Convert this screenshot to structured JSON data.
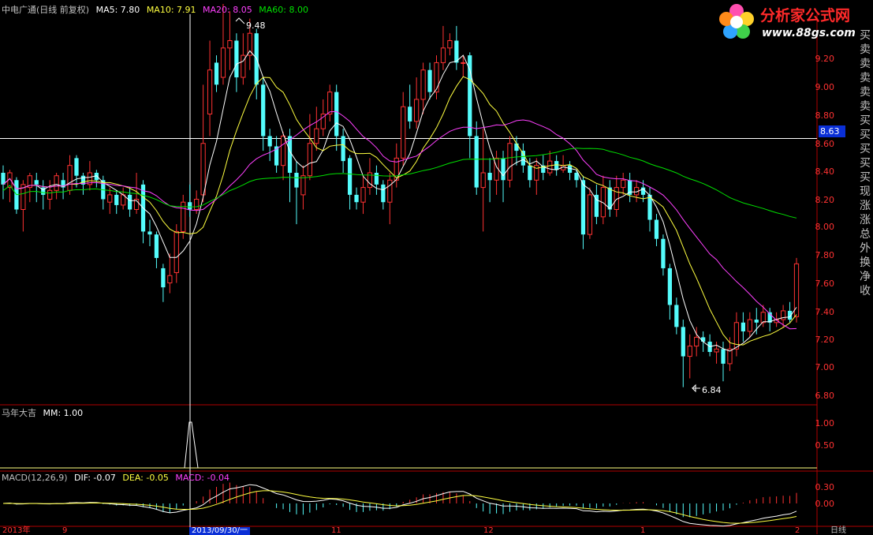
{
  "header": {
    "stock_name": "中电广通(日线 前复权)",
    "ma5": "MA5: 7.80",
    "ma10": "MA10: 7.91",
    "ma20": "MA20: 8.05",
    "ma60": "MA60: 8.00"
  },
  "colors": {
    "ma5": "#ffffff",
    "ma10": "#ffff40",
    "ma20": "#ff40ff",
    "ma60": "#00e000",
    "up": "#ff3232",
    "down": "#54fcfc",
    "axis": "#b00000"
  },
  "main_axis": {
    "labels": [
      "9.20",
      "9.00",
      "8.80",
      "8.60",
      "8.40",
      "8.20",
      "8.00",
      "7.80",
      "7.60",
      "7.40",
      "7.20",
      "7.00",
      "6.80"
    ]
  },
  "annotations": {
    "high": "9.48",
    "low": "6.84",
    "crosshair_price": "8.63"
  },
  "logo": {
    "title": "分析家公式网",
    "url": "www.88gs.com"
  },
  "right_panel": [
    "买",
    "卖",
    "卖",
    "卖",
    "卖",
    "卖",
    "买",
    "买",
    "买",
    "买",
    "买",
    "现",
    "涨",
    "涨",
    "总",
    "外",
    "换",
    "净",
    "收"
  ],
  "indicator1": {
    "title": "马年大吉",
    "mm": "MM: 1.00",
    "axis": [
      "1.00",
      "0.50"
    ]
  },
  "macd": {
    "title": "MACD(12,26,9)",
    "dif": "DIF: -0.07",
    "dea": "DEA: -0.05",
    "macd": "MACD: -0.04",
    "axis": [
      "0.30",
      "0.00"
    ]
  },
  "dates": {
    "d1": "2013年",
    "d2": "9",
    "crosshair_date": "2013/09/30/一",
    "d3": "11",
    "d4": "12",
    "d5": "1",
    "d6": "2",
    "period": "日线"
  },
  "chart_data": {
    "type": "candlestick",
    "ylim": [
      6.72,
      9.38
    ],
    "candles": [
      [
        8.3,
        8.22,
        8.35,
        8.12
      ],
      [
        8.2,
        8.3,
        8.32,
        8.1
      ],
      [
        8.25,
        8.05,
        8.27,
        8.02
      ],
      [
        8.05,
        8.22,
        8.25,
        7.9
      ],
      [
        8.2,
        8.28,
        8.3,
        8.1
      ],
      [
        8.25,
        8.22,
        8.3,
        8.1
      ],
      [
        8.2,
        8.15,
        8.25,
        8.05
      ],
      [
        8.12,
        8.18,
        8.25,
        8.05
      ],
      [
        8.18,
        8.28,
        8.3,
        8.12
      ],
      [
        8.25,
        8.2,
        8.3,
        8.12
      ],
      [
        8.18,
        8.35,
        8.42,
        8.15
      ],
      [
        8.4,
        8.28,
        8.42,
        8.2
      ],
      [
        8.28,
        8.22,
        8.3,
        8.15
      ],
      [
        8.22,
        8.3,
        8.38,
        8.18
      ],
      [
        8.3,
        8.25,
        8.32,
        8.2
      ],
      [
        8.25,
        8.12,
        8.28,
        8.05
      ],
      [
        8.1,
        8.15,
        8.2,
        8.02
      ],
      [
        8.15,
        8.08,
        8.18,
        8.02
      ],
      [
        8.08,
        8.15,
        8.2,
        8.05
      ],
      [
        8.15,
        8.05,
        8.2,
        8.0
      ],
      [
        8.05,
        8.12,
        8.3,
        8.02
      ],
      [
        8.22,
        7.9,
        8.25,
        7.82
      ],
      [
        7.9,
        7.88,
        7.98,
        7.8
      ],
      [
        7.88,
        7.72,
        7.9,
        7.65
      ],
      [
        7.65,
        7.52,
        7.68,
        7.42
      ],
      [
        7.55,
        7.6,
        7.75,
        7.48
      ],
      [
        7.62,
        7.9,
        7.95,
        7.55
      ],
      [
        7.9,
        8.1,
        8.15,
        7.85
      ],
      [
        8.1,
        8.05,
        8.22,
        8.0
      ],
      [
        8.05,
        8.12,
        8.18,
        8.02
      ],
      [
        8.15,
        8.5,
        8.9,
        8.1
      ],
      [
        8.7,
        9.0,
        9.2,
        8.55
      ],
      [
        9.05,
        8.9,
        9.1,
        8.85
      ],
      [
        8.95,
        9.15,
        9.45,
        8.9
      ],
      [
        9.15,
        9.2,
        9.4,
        9.0
      ],
      [
        9.2,
        8.95,
        9.25,
        8.85
      ],
      [
        8.95,
        9.1,
        9.25,
        8.9
      ],
      [
        9.1,
        9.25,
        9.35,
        9.0
      ],
      [
        9.25,
        8.9,
        9.28,
        8.8
      ],
      [
        8.9,
        8.55,
        8.95,
        8.45
      ],
      [
        8.55,
        8.48,
        8.6,
        8.38
      ],
      [
        8.48,
        8.35,
        8.55,
        8.3
      ],
      [
        8.35,
        8.55,
        8.58,
        8.25
      ],
      [
        8.55,
        8.3,
        8.6,
        8.1
      ],
      [
        8.3,
        8.2,
        8.38,
        7.95
      ],
      [
        8.15,
        8.28,
        8.35,
        8.05
      ],
      [
        8.28,
        8.5,
        8.7,
        8.25
      ],
      [
        8.5,
        8.6,
        8.75,
        8.45
      ],
      [
        8.6,
        8.7,
        8.8,
        8.55
      ],
      [
        8.7,
        8.85,
        8.9,
        8.65
      ],
      [
        8.85,
        8.55,
        8.9,
        8.45
      ],
      [
        8.55,
        8.38,
        8.6,
        8.3
      ],
      [
        8.4,
        8.15,
        8.42,
        8.05
      ],
      [
        8.15,
        8.1,
        8.2,
        8.05
      ],
      [
        8.1,
        8.2,
        8.28,
        8.02
      ],
      [
        8.2,
        8.3,
        8.4,
        8.15
      ],
      [
        8.3,
        8.22,
        8.35,
        8.15
      ],
      [
        8.22,
        8.1,
        8.25,
        8.05
      ],
      [
        8.1,
        8.25,
        8.3,
        7.95
      ],
      [
        8.25,
        8.4,
        8.5,
        8.2
      ],
      [
        8.4,
        8.75,
        8.85,
        8.35
      ],
      [
        8.75,
        8.65,
        8.9,
        8.6
      ],
      [
        8.65,
        8.8,
        8.95,
        8.6
      ],
      [
        8.8,
        9.0,
        9.05,
        8.7
      ],
      [
        9.0,
        8.85,
        9.05,
        8.8
      ],
      [
        8.85,
        9.05,
        9.1,
        8.8
      ],
      [
        9.05,
        9.15,
        9.3,
        9.0
      ],
      [
        9.15,
        9.2,
        9.25,
        9.1
      ],
      [
        9.2,
        9.05,
        9.3,
        9.0
      ],
      [
        9.05,
        9.05,
        9.1,
        8.95
      ],
      [
        9.1,
        8.55,
        9.12,
        8.4
      ],
      [
        8.55,
        8.2,
        8.65,
        8.15
      ],
      [
        8.2,
        8.3,
        8.6,
        7.9
      ],
      [
        8.3,
        8.25,
        8.4,
        8.1
      ],
      [
        8.25,
        8.4,
        8.45,
        8.15
      ],
      [
        8.4,
        8.25,
        8.45,
        8.1
      ],
      [
        8.25,
        8.5,
        8.55,
        8.2
      ],
      [
        8.5,
        8.45,
        8.55,
        8.35
      ],
      [
        8.45,
        8.35,
        8.5,
        8.3
      ],
      [
        8.35,
        8.25,
        8.4,
        8.2
      ],
      [
        8.25,
        8.35,
        8.4,
        8.15
      ],
      [
        8.35,
        8.3,
        8.42,
        8.25
      ],
      [
        8.3,
        8.38,
        8.45,
        8.28
      ],
      [
        8.38,
        8.32,
        8.42,
        8.28
      ],
      [
        8.32,
        8.35,
        8.42,
        8.3
      ],
      [
        8.35,
        8.3,
        8.38,
        8.25
      ],
      [
        8.3,
        8.25,
        8.32,
        8.2
      ],
      [
        8.25,
        7.88,
        8.28,
        7.78
      ],
      [
        7.88,
        8.15,
        8.2,
        7.85
      ],
      [
        8.15,
        8.0,
        8.22,
        7.95
      ],
      [
        8.0,
        8.2,
        8.28,
        7.95
      ],
      [
        8.2,
        8.05,
        8.25,
        8.0
      ],
      [
        8.05,
        8.2,
        8.28,
        8.0
      ],
      [
        8.2,
        8.25,
        8.3,
        8.15
      ],
      [
        8.25,
        8.15,
        8.3,
        8.1
      ],
      [
        8.15,
        8.2,
        8.25,
        8.1
      ],
      [
        8.2,
        8.15,
        8.25,
        8.1
      ],
      [
        8.15,
        7.98,
        8.2,
        7.9
      ],
      [
        7.98,
        7.85,
        8.02,
        7.8
      ],
      [
        7.85,
        7.65,
        7.88,
        7.6
      ],
      [
        7.65,
        7.4,
        7.68,
        7.3
      ],
      [
        7.4,
        7.25,
        7.45,
        7.2
      ],
      [
        7.25,
        7.05,
        7.3,
        6.84
      ],
      [
        7.05,
        7.12,
        7.2,
        6.9
      ],
      [
        7.12,
        7.18,
        7.25,
        7.05
      ],
      [
        7.18,
        7.15,
        7.22,
        7.08
      ],
      [
        7.15,
        7.08,
        7.2,
        7.05
      ],
      [
        7.08,
        7.1,
        7.15,
        7.0
      ],
      [
        7.1,
        7.0,
        7.15,
        6.88
      ],
      [
        7.0,
        7.1,
        7.18,
        6.95
      ],
      [
        7.1,
        7.28,
        7.35,
        7.05
      ],
      [
        7.28,
        7.22,
        7.35,
        7.15
      ],
      [
        7.22,
        7.3,
        7.35,
        7.18
      ],
      [
        7.3,
        7.28,
        7.38,
        7.2
      ],
      [
        7.28,
        7.35,
        7.4,
        7.25
      ],
      [
        7.35,
        7.28,
        7.38,
        7.22
      ],
      [
        7.28,
        7.3,
        7.35,
        7.25
      ],
      [
        7.3,
        7.36,
        7.4,
        7.25
      ],
      [
        7.36,
        7.3,
        7.42,
        7.28
      ],
      [
        7.32,
        7.68,
        7.72,
        7.28
      ]
    ]
  }
}
